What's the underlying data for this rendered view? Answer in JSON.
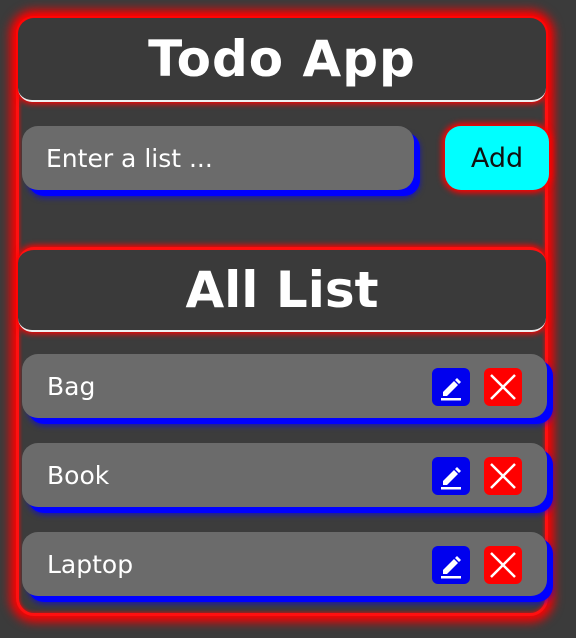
{
  "app": {
    "title": "Todo App"
  },
  "input": {
    "placeholder": "Enter a list ...",
    "value": ""
  },
  "add_button": {
    "label": "Add"
  },
  "list": {
    "title": "All List",
    "items": [
      {
        "text": "Bag"
      },
      {
        "text": "Book"
      },
      {
        "text": "Laptop"
      }
    ]
  },
  "icons": {
    "edit": "edit-icon",
    "delete": "close-icon"
  },
  "colors": {
    "background": "#3b3b3b",
    "glow": "#ff0000",
    "item_background": "#6b6b6b",
    "item_shadow": "#0000ff",
    "add_button": "#00ffff",
    "edit_button": "#0000ee",
    "delete_button": "#ff0000",
    "text": "#ffffff"
  }
}
